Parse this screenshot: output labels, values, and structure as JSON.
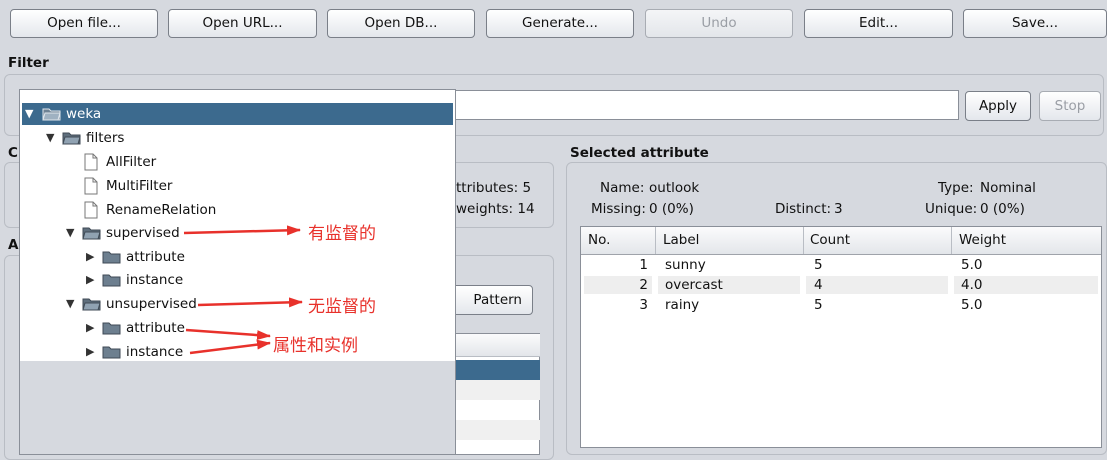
{
  "toolbar": {
    "open_file": "Open file...",
    "open_url": "Open URL...",
    "open_db": "Open DB...",
    "generate": "Generate...",
    "undo": "Undo",
    "edit": "Edit...",
    "save": "Save..."
  },
  "filter": {
    "title": "Filter",
    "apply": "Apply",
    "stop": "Stop"
  },
  "current_relation": {
    "title_initial": "C",
    "attributes_label": "ttributes:",
    "attributes_value": "5",
    "weights_label": "weights:",
    "weights_value": "14"
  },
  "attributes_panel": {
    "title_initial": "A",
    "pattern_button": "Pattern"
  },
  "selected_attribute": {
    "title": "Selected attribute",
    "name_label": "Name:",
    "name_value": "outlook",
    "type_label": "Type:",
    "type_value": "Nominal",
    "missing_label": "Missing:",
    "missing_value": "0 (0%)",
    "distinct_label": "Distinct:",
    "distinct_value": "3",
    "unique_label": "Unique:",
    "unique_value": "0 (0%)",
    "table": {
      "headers": [
        "No.",
        "Label",
        "Count",
        "Weight"
      ],
      "rows": [
        {
          "no": "1",
          "label": "sunny",
          "count": "5",
          "weight": "5.0"
        },
        {
          "no": "2",
          "label": "overcast",
          "count": "4",
          "weight": "4.0"
        },
        {
          "no": "3",
          "label": "rainy",
          "count": "5",
          "weight": "5.0"
        }
      ]
    }
  },
  "tree": {
    "root": "weka",
    "filters": "filters",
    "allfilter": "AllFilter",
    "multifilter": "MultiFilter",
    "renamerelation": "RenameRelation",
    "supervised": "supervised",
    "sup_attribute": "attribute",
    "sup_instance": "instance",
    "unsupervised": "unsupervised",
    "unsup_attribute": "attribute",
    "unsup_instance": "instance"
  },
  "annotations": {
    "supervised": "有监督的",
    "unsupervised": "无监督的",
    "attr_instance": "属性和实例"
  },
  "colors": {
    "selection": "#3c6a8e",
    "annotation": "#e8312b"
  }
}
